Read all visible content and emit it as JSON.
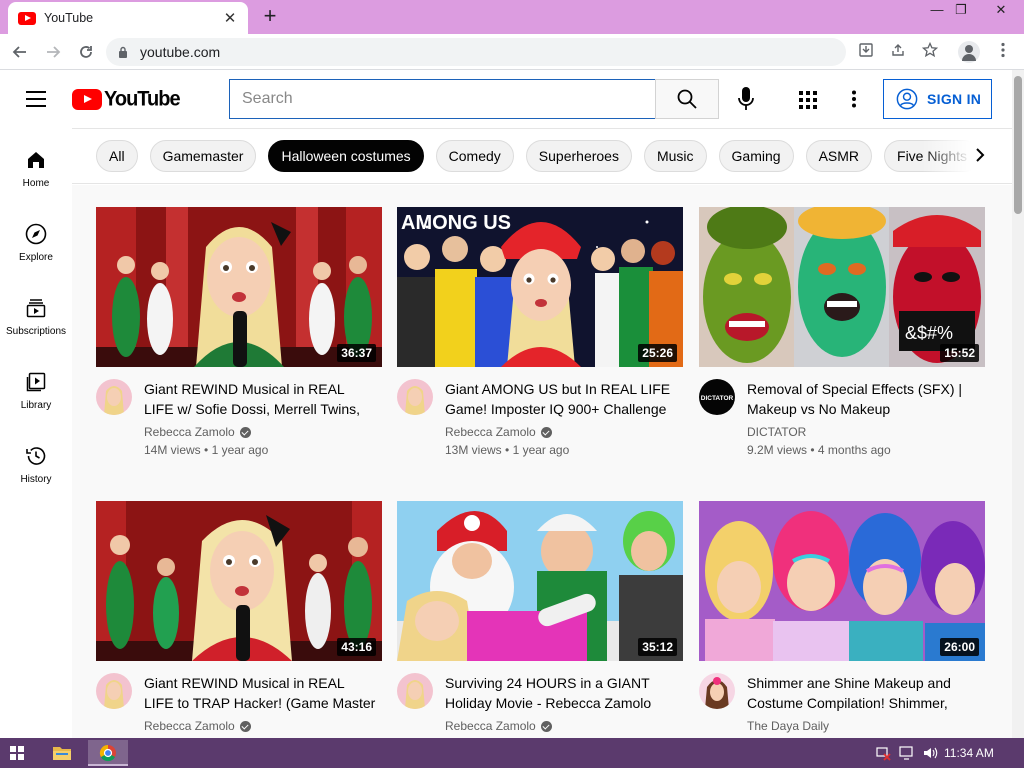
{
  "browser": {
    "tab_title": "YouTube",
    "tab_close": "✕",
    "new_tab": "+",
    "url": "youtube.com",
    "window_min": "—",
    "window_max": "❐",
    "window_close": "✕"
  },
  "header": {
    "logo_text": "YouTube",
    "search_placeholder": "Search",
    "signin_label": "SIGN IN"
  },
  "chips": [
    "All",
    "Gamemaster",
    "Halloween costumes",
    "Comedy",
    "Superheroes",
    "Music",
    "Gaming",
    "ASMR",
    "Five Nights"
  ],
  "active_chip": "Halloween costumes",
  "sidebar": [
    {
      "label": "Home",
      "icon": "home-icon"
    },
    {
      "label": "Explore",
      "icon": "compass-icon"
    },
    {
      "label": "Subscriptions",
      "icon": "subscriptions-icon"
    },
    {
      "label": "Library",
      "icon": "library-icon"
    },
    {
      "label": "History",
      "icon": "history-icon"
    }
  ],
  "videos": [
    {
      "title": "Giant REWIND Musical in REAL LIFE w/ Sofie Dossi, Merrell Twins, Rebecca Zamolo",
      "channel": "Rebecca Zamolo",
      "verified": true,
      "views": "14M views",
      "age": "1 year ago",
      "duration": "36:37"
    },
    {
      "title": "Giant AMONG US but In REAL LIFE Game! Imposter IQ 900+ Challenge",
      "channel": "Rebecca Zamolo",
      "verified": true,
      "views": "13M views",
      "age": "1 year ago",
      "duration": "25:26"
    },
    {
      "title": "Removal of Special Effects (SFX) | Makeup vs No Makeup",
      "channel": "DICTATOR",
      "verified": false,
      "views": "9.2M views",
      "age": "4 months ago",
      "duration": "15:52"
    },
    {
      "title": "Giant REWIND Musical in REAL LIFE to TRAP Hacker! (Game Master Network)",
      "channel": "Rebecca Zamolo",
      "verified": true,
      "views": "",
      "age": "",
      "duration": "43:16"
    },
    {
      "title": "Surviving 24 HOURS in a GIANT Holiday Movie - Rebecca Zamolo",
      "channel": "Rebecca Zamolo",
      "verified": true,
      "views": "",
      "age": "",
      "duration": "35:12"
    },
    {
      "title": "Shimmer ane Shine Makeup and Costume Compilation! Shimmer, Shine and Leah",
      "channel": "The Daya Daily",
      "verified": false,
      "views": "",
      "age": "",
      "duration": "26:00"
    }
  ],
  "channel_avatar_labels": {
    "dictator": "DICTATOR"
  },
  "taskbar": {
    "clock": "11:34 AM"
  },
  "colors": {
    "tabbar": "#dc9ce0",
    "youtube_red": "#ff0000",
    "signin_blue": "#065fd4",
    "taskbar": "#5b3a6d"
  }
}
